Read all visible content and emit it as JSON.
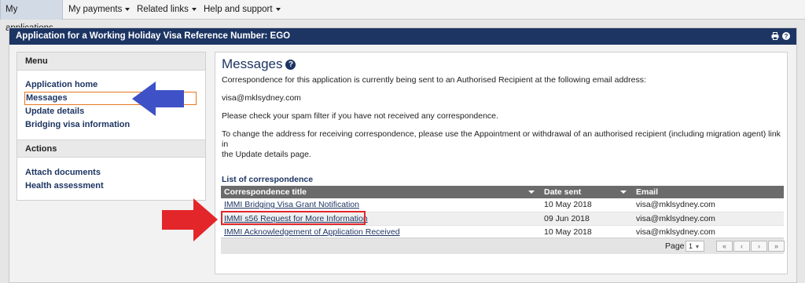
{
  "topnav": {
    "tabs": [
      {
        "label": "My applications",
        "active": true,
        "dropdown": false
      },
      {
        "label": "My payments",
        "active": false,
        "dropdown": true
      },
      {
        "label": "Related links",
        "active": false,
        "dropdown": true
      },
      {
        "label": "Help and support",
        "active": false,
        "dropdown": true
      }
    ]
  },
  "panel": {
    "title": "Application for a Working Holiday Visa Reference Number: EGO",
    "icons": [
      "print-icon",
      "help-icon"
    ]
  },
  "menu": {
    "heading": "Menu",
    "items": [
      {
        "label": "Application home"
      },
      {
        "label": "Messages",
        "active": true
      },
      {
        "label": "Update details"
      },
      {
        "label": "Bridging visa information"
      }
    ],
    "actions_heading": "Actions",
    "actions": [
      {
        "label": "Attach documents"
      },
      {
        "label": "Health assessment"
      }
    ]
  },
  "messages": {
    "title": "Messages",
    "intro": "Correspondence for this application is currently being sent to an Authorised Recipient at the following email address:",
    "email": "visa@mklsydney.com",
    "spam_note": "Please check your spam filter if you have not received any correspondence.",
    "change_line1": "To change the address for receiving correspondence, please use the Appointment or withdrawal of an authorised recipient (including migration agent) link in",
    "change_line2": "the Update details page.",
    "list_title": "List of correspondence",
    "columns": [
      "Correspondence title",
      "Date sent",
      "Email"
    ],
    "rows": [
      {
        "title": "IMMI Bridging Visa Grant Notification",
        "date": "10 May 2018",
        "email": "visa@mklsydney.com"
      },
      {
        "title": "IMMI s56 Request for More Information",
        "date": "09 Jun 2018",
        "email": "visa@mklsydney.com"
      },
      {
        "title": "IMMI Acknowledgement of Application Received",
        "date": "10 May 2018",
        "email": "visa@mklsydney.com"
      }
    ],
    "pager": {
      "label": "Page",
      "current": "1",
      "buttons": [
        "«",
        "‹",
        "›",
        "»"
      ]
    }
  },
  "colors": {
    "brand_navy": "#1d3563",
    "annotation_blue": "#3f51c7",
    "annotation_red": "#e3262a",
    "active_menu_border": "#e87722"
  }
}
